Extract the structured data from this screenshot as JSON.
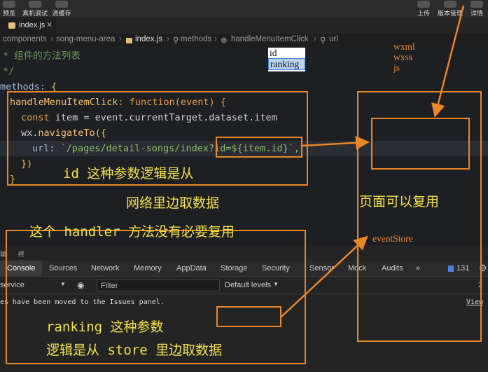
{
  "toolbar": {
    "left_buttons": [
      "预览",
      "真机调试",
      "清缓存"
    ],
    "right_buttons": [
      "上传",
      "版本管理",
      "详情"
    ]
  },
  "tabs": [
    {
      "label": "index.js"
    }
  ],
  "breadcrumb": [
    "components",
    "song-menu-area",
    "index.js",
    "methods",
    "handleMenuItemClick",
    "url"
  ],
  "code": {
    "line1": "* 组件的方法列表",
    "line2": "*/",
    "line3_a": "methods: ",
    "line3_b": "{",
    "line4_fn": "handleMenuItemClick",
    "line4_rest": ": function(event) {",
    "line5_kw": "const",
    "line5_rest": " item = event.currentTarget.dataset.item",
    "line6_a": "wx.",
    "line6_fn": "navigateTo",
    "line6_b": "({",
    "line7_prop": "url",
    "line7_colon": ": ",
    "line7_str": "`/pages/detail-songs/index",
    "line7_str2": "?id=${item.id}",
    "line7_end": "`,",
    "line8": "})",
    "line9": "}"
  },
  "devtools": {
    "small_tabs": [
      "输出",
      "终端"
    ],
    "tabs": [
      "Console",
      "Sources",
      "Network",
      "Memory",
      "AppData",
      "Storage",
      "Security",
      "Sensor",
      "Mock",
      "Audits",
      "»"
    ],
    "issue_count": "131",
    "context": "service",
    "filter_placeholder": "Filter",
    "levels": "Default levels",
    "hidden_count": "2",
    "message": "es have been moved to the Issues panel.",
    "view_link": "View"
  },
  "annotations": {
    "note_id": "id",
    "note_ranking": "ranking",
    "note_wxml": "wxml",
    "note_wxss": "wxss",
    "note_js": "js",
    "event_store": "eventStore",
    "text1": "id 这种参数逻辑是从",
    "text2": "网络里边取数据",
    "text3": "这个 handler 方法没有必要复用",
    "text4": "页面可以复用",
    "text5": "ranking 这种参数",
    "text6": "逻辑是从 store 里边取数据"
  },
  "colors": {
    "annotation_box": "#e8862a",
    "annotation_text": "#f2e14a"
  }
}
